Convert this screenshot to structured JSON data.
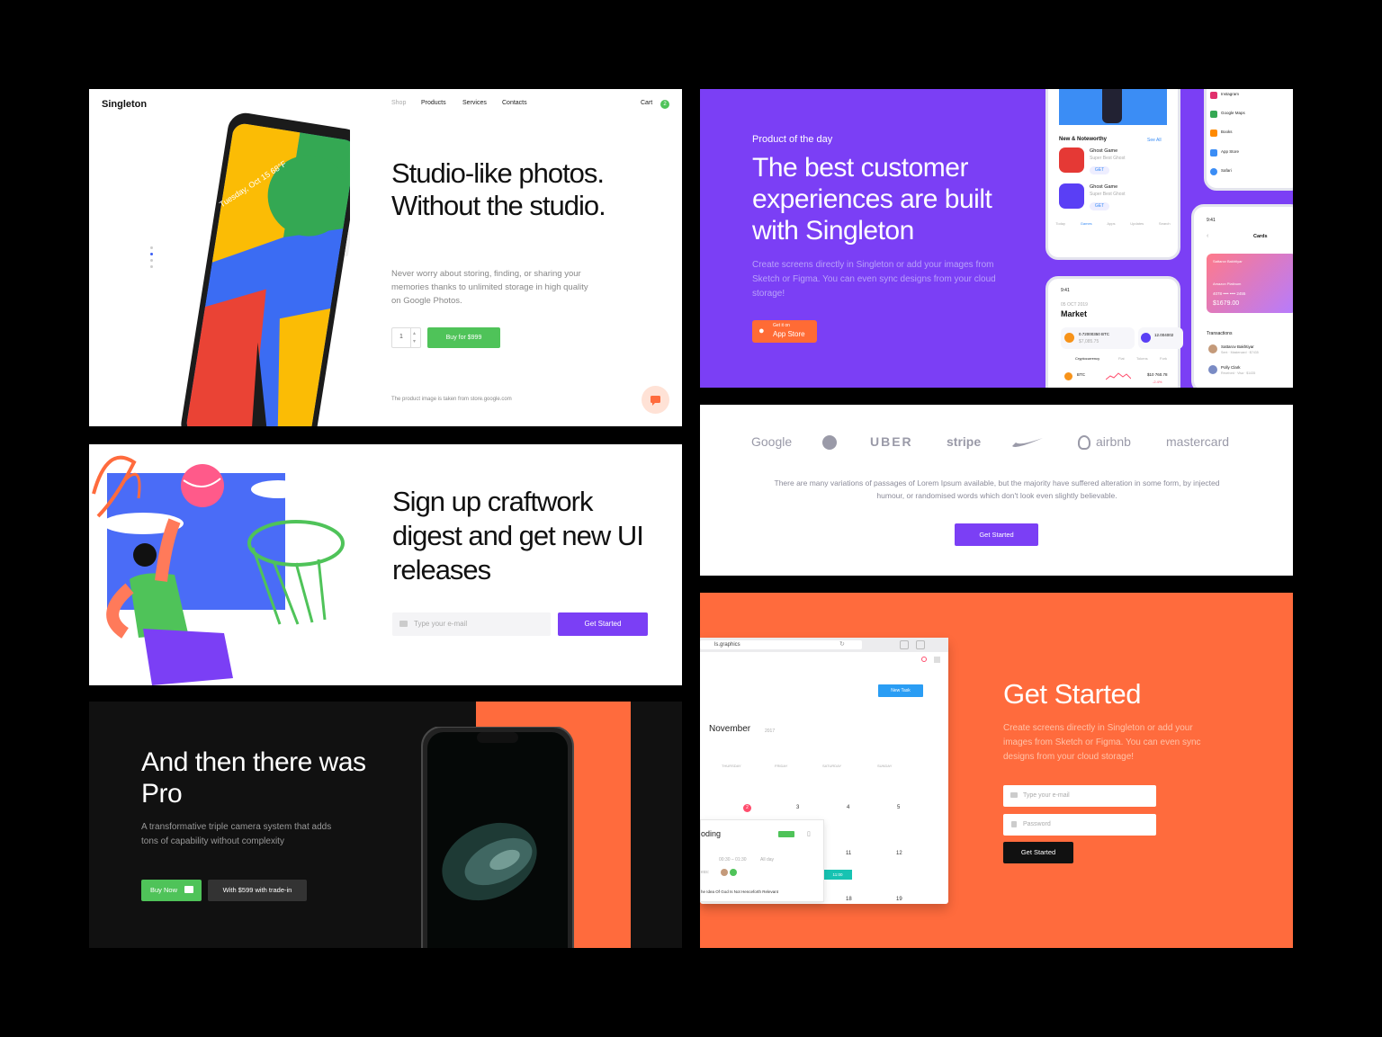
{
  "panel1": {
    "logo": "Singleton",
    "nav": [
      "Shop",
      "Products",
      "Services",
      "Contacts"
    ],
    "cart_label": "Cart",
    "cart_count": "2",
    "phone_date": "Tuesday, Oct 15",
    "phone_temp": "68°F",
    "headline": "Studio-like photos. Without the studio.",
    "description": "Never worry about storing, finding, or sharing your memories thanks to unlimited storage in high quality on Google Photos.",
    "qty": "1",
    "buy_label": "Buy for $999",
    "footnote": "The product image is taken from store.google.com"
  },
  "panel2": {
    "eyebrow": "Product of the day",
    "headline": "The best customer experiences are built with Singleton",
    "description": "Create screens directly in Singleton or add your images from Sketch or Figma. You can even sync designs from your cloud storage!",
    "store_small": "Get it on",
    "store_big": "App Store",
    "app": {
      "section": "New & Noteworthy",
      "see_all": "See All",
      "items": [
        {
          "name": "Ghost Game",
          "sub": "Super Best Ghost",
          "cta": "GET"
        },
        {
          "name": "Ghost Game",
          "sub": "Super Best Ghost",
          "cta": "GET"
        }
      ],
      "tabs": [
        "Today",
        "Games",
        "Apps",
        "Updates",
        "Search"
      ]
    },
    "list": [
      "Instagram",
      "Google Maps",
      "Books",
      "App Store",
      "Safari"
    ],
    "market": {
      "time": "9:41",
      "date": "05 OCT 2019",
      "title": "Market",
      "btc_amount": "0.72000350 BTC",
      "btc_value": "$7,085.75",
      "eth_amount": "12.004002",
      "tabs": [
        "Cryptocurrency",
        "Fiat",
        "Tokens",
        "Fork"
      ],
      "row_coin": "BTC",
      "row_price": "$10 760.78",
      "row_change": "-2.4%"
    },
    "cards": {
      "time": "9:41",
      "title": "Cards",
      "card_name": "Sattarov Bakhtiyar",
      "card_type": "Amazon Platinum",
      "card_number": "4078 •••• •••• 2455",
      "balance": "$1679.00",
      "transactions_title": "Transactions",
      "transactions": [
        {
          "name": "Sattarov Bakhtiyar",
          "detail": "Sent · Mastercard · $7435"
        },
        {
          "name": "Polly Clark",
          "detail": "Received · Visa · $1435"
        }
      ]
    }
  },
  "panel3": {
    "headline": "Sign up craftwork digest and get new UI releases",
    "email_placeholder": "Type your e-mail",
    "button": "Get Started"
  },
  "panel4": {
    "logos": [
      "Google",
      "UBER",
      "stripe",
      "airbnb",
      "mastercard"
    ],
    "text": "There are many variations of passages of Lorem Ipsum available, but the majority have suffered alteration in some form, by injected humour, or randomised words which don't look even slightly believable.",
    "button": "Get Started"
  },
  "panel5": {
    "headline": "And then there was Pro",
    "description": "A transformative triple  camera system that adds tons of capability without complexity",
    "buy_label": "Buy Now",
    "trade_label": "With $599 with trade-in"
  },
  "panel6": {
    "headline": "Get Started",
    "description": "Create screens directly in Singleton or add your images from Sketch or Figma. You can even sync designs from your cloud storage!",
    "email_placeholder": "Type your e-mail",
    "password_placeholder": "Password",
    "button": "Get Started",
    "browser": {
      "url": "ls.graphics",
      "new_task": "New Task",
      "month": "November",
      "year": "2017",
      "weekdays": [
        "THURSDAY",
        "FRIDAY",
        "SATURDAY",
        "SUNDAY"
      ],
      "dates_row1": [
        "2",
        "3",
        "4",
        "5"
      ],
      "dates_row2": [
        "11",
        "12"
      ],
      "dates_row3": [
        "18",
        "19"
      ],
      "task_title": "oding",
      "task_time": "00:30 – 01:30",
      "task_allday": "All day",
      "task_note": "he Idea Of God Is Not Henceforth Relevant",
      "event_time": "11:00",
      "assignees_label": "ess:"
    }
  },
  "colors": {
    "purple": "#7b3ff5",
    "orange": "#ff6b3d",
    "green": "#4fc359",
    "dark": "#111111"
  }
}
